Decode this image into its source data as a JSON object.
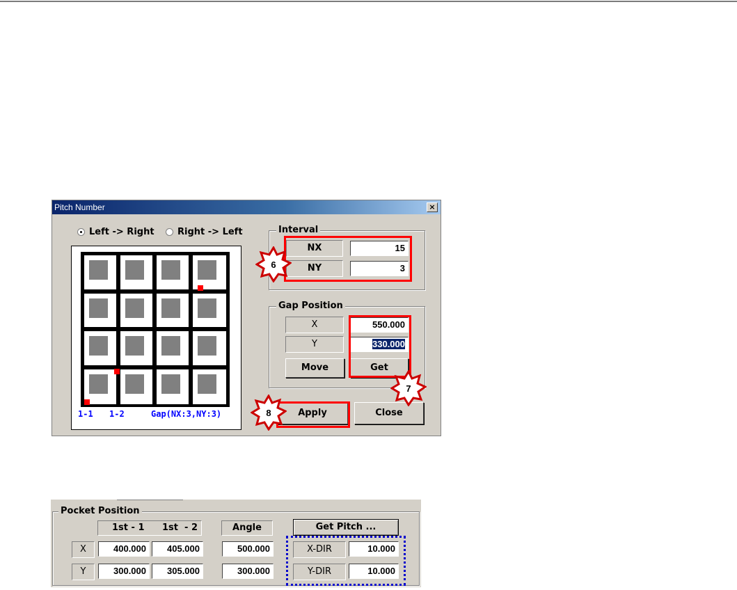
{
  "dialog": {
    "title": "Pitch Number",
    "close_glyph": "×",
    "radio_left_right": "Left -> Right",
    "radio_right_left": "Right -> Left",
    "grid_labels": {
      "first": "1-1",
      "second": "1-2",
      "gap": "Gap(NX:3,NY:3)"
    },
    "interval": {
      "title": "Interval",
      "nx_label": "NX",
      "nx_value": "15",
      "ny_label": "NY",
      "ny_value": "3"
    },
    "gap_position": {
      "title": "Gap Position",
      "x_label": "X",
      "x_value": "550.000",
      "y_label": "Y",
      "y_value": "330.000",
      "move_label": "Move",
      "get_label": "Get"
    },
    "apply_label": "Apply",
    "close_label": "Close",
    "callouts": [
      "6",
      "7",
      "8"
    ]
  },
  "pocket": {
    "title": "Pocket Position",
    "col1": "1st - 1",
    "col2": "1st  - 2",
    "angle_label": "Angle",
    "get_pitch_label": "Get Pitch ...",
    "x_label": "X",
    "y_label": "Y",
    "x1": "400.000",
    "x2": "405.000",
    "y1": "300.000",
    "y2": "305.000",
    "angle_x": "500.000",
    "angle_y": "300.000",
    "xdir_label": "X-DIR",
    "xdir_value": "10.000",
    "ydir_label": "Y-DIR",
    "ydir_value": "10.000"
  },
  "colors": {
    "highlight_red": "#ff0000",
    "dotted_blue": "#0000cc",
    "label_blue": "#0000ff"
  }
}
